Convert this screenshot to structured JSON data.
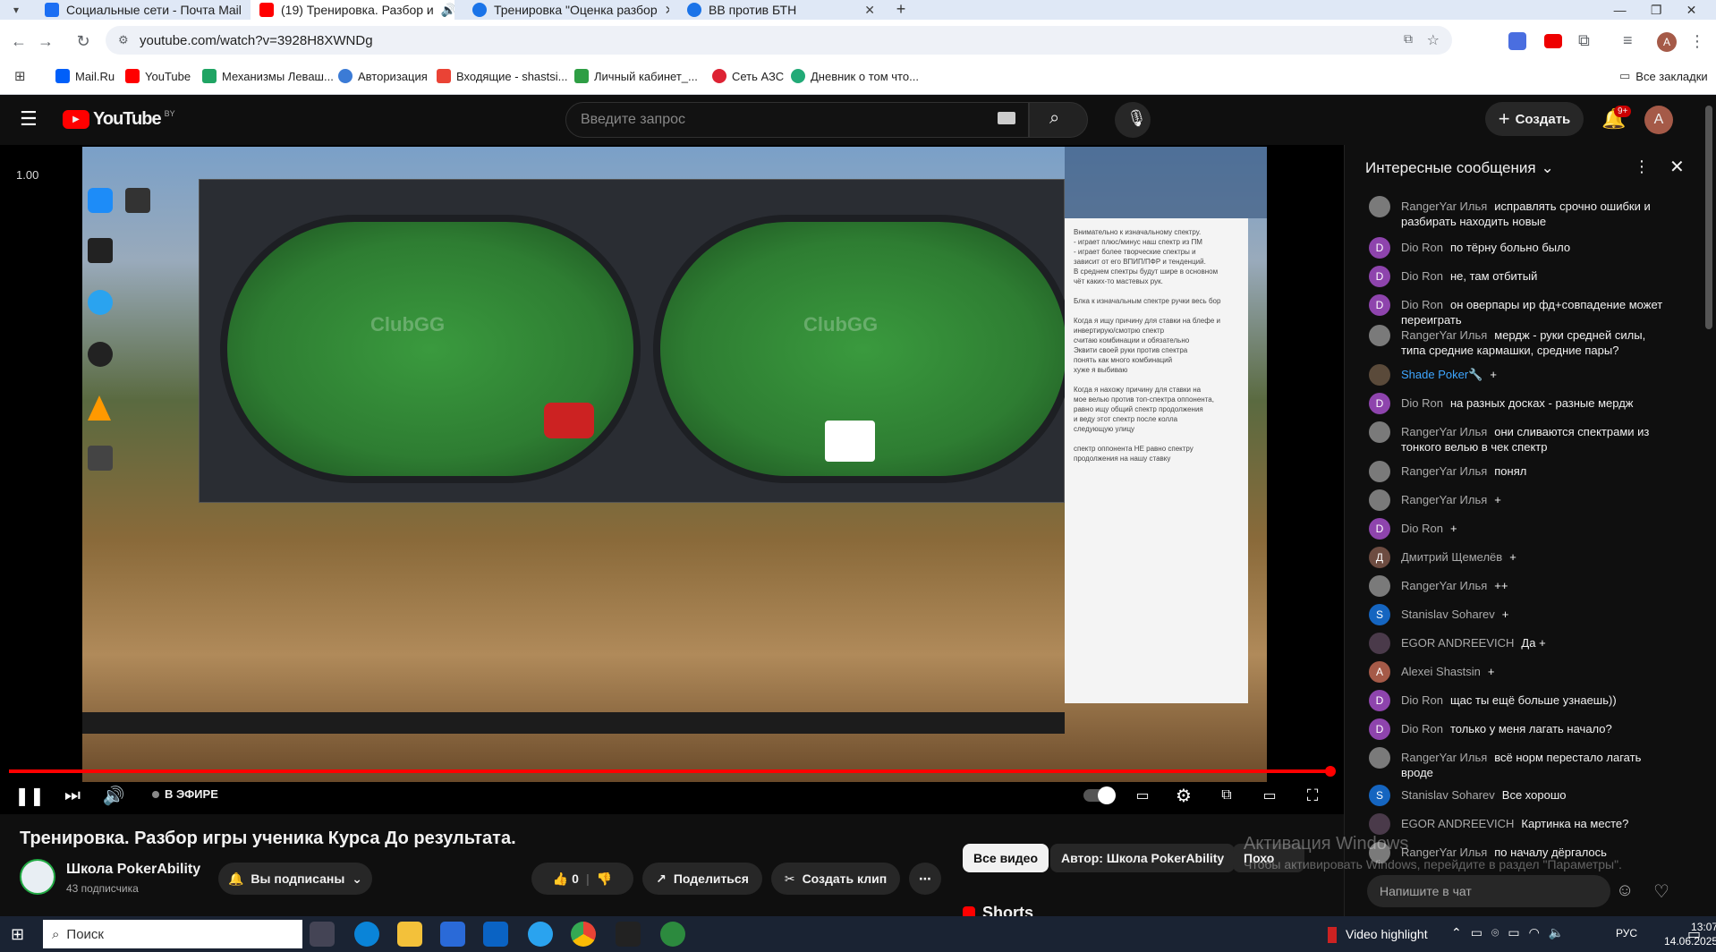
{
  "browser": {
    "tabs": [
      {
        "title": "Социальные сети - Почта Mail",
        "color": "#1b6ef3"
      },
      {
        "title": "(19) Тренировка. Разбор и",
        "color": "#ff0000"
      },
      {
        "title": "Тренировка \"Оценка разбор",
        "color": "#1a73e8"
      },
      {
        "title": "BB против БТН",
        "color": "#1a73e8"
      }
    ],
    "url": "youtube.com/watch?v=3928H8XWNDg",
    "bookmarks": [
      {
        "label": "Mail.Ru",
        "color": "#005ff9"
      },
      {
        "label": "YouTube",
        "color": "#ff0000"
      },
      {
        "label": "Механизмы Леваш...",
        "color": "#1fa463"
      },
      {
        "label": "Авторизация",
        "color": "#3b7bd6"
      },
      {
        "label": "Входящие - shastsi...",
        "color": "#ea4335"
      },
      {
        "label": "Личный кабинет_...",
        "color": "#2e9e44"
      },
      {
        "label": "Сеть АЗС",
        "color": "#d23"
      },
      {
        "label": "Дневник о том что...",
        "color": "#2a7"
      }
    ],
    "all_bookmarks": "Все закладки"
  },
  "youtube": {
    "logo": "YouTube",
    "region": "BY",
    "search_placeholder": "Введите запрос",
    "create_label": "Создать",
    "notifications": "9+",
    "avatar_letter": "A"
  },
  "video": {
    "speed_label": "1.00",
    "live_label": "В ЭФИРЕ",
    "title": "Тренировка. Разбор игры ученика Курса До результата.",
    "progress": 1.0,
    "notepad_text": "Внимательно к изначальному спектру.\n- играет плюс/минус наш спектр из ПМ\n- играет более творческие спектры и\nзависит от его ВПИП/ПФР и тенденций.\nВ среднем спектры будут шире в основном\nчёт каких-то мастевых рук.\n\nБлка к изначальным спектре ручки весь бор\n\nКогда я ищу причину для ставки на блефе и инвертирую/смотрю спектр\nсчитаю комбинации и обязательно\nЭквити своей руки против спектра\nпонять как много комбинаций\nхуже я выбиваю\n\nКогда я нахожу причину для ставки на\nмое велью против топ-спектра оппонента,\nравно ищу общий спектр продолжения\nи веду этот спектр после колла\nследующую улицу\n\nспектр оппонента НЕ равно спектру\nпродолжения на нашу ставку"
  },
  "channel": {
    "name": "Школа PokerAbility",
    "subscribers": "43 подписчика",
    "subscribed_label": "Вы подписаны",
    "likes": "0",
    "share_label": "Поделиться",
    "clip_label": "Создать клип"
  },
  "chips": {
    "all_videos": "Все видео",
    "author": "Автор: Школа PokerAbility",
    "similar": "Похо",
    "shorts": "Shorts"
  },
  "chat": {
    "header": "Интересные сообщения",
    "input_placeholder": "Напишите в чат",
    "messages": [
      {
        "author": "RangerYar Илья",
        "text": "исправлять срочно ошибки и разбирать находить новые",
        "avatar": "photo",
        "color": "#7a7a7a"
      },
      {
        "author": "Dio Ron",
        "text": "по тёрну больно было",
        "avatar": "D",
        "color": "#8e44ad"
      },
      {
        "author": "Dio Ron",
        "text": "не, там отбитый",
        "avatar": "D",
        "color": "#8e44ad"
      },
      {
        "author": "Dio Ron",
        "text": "он оверпары ир фд+совпадение может переиграть",
        "avatar": "D",
        "color": "#8e44ad"
      },
      {
        "author": "RangerYar Илья",
        "text": "мердж - руки средней силы, типа средние кармашки, средние пары?",
        "avatar": "photo",
        "color": "#7a7a7a"
      },
      {
        "author": "Shade Poker🔧",
        "text": "+",
        "avatar": "photo",
        "color": "#5a4a3a",
        "author_color": "#3ea6ff"
      },
      {
        "author": "Dio Ron",
        "text": "на разных досках - разные мердж",
        "avatar": "D",
        "color": "#8e44ad"
      },
      {
        "author": "RangerYar Илья",
        "text": "они сливаются спектрами из тонкого велью в чек спектр",
        "avatar": "photo",
        "color": "#7a7a7a"
      },
      {
        "author": "RangerYar Илья",
        "text": "понял",
        "avatar": "photo",
        "color": "#7a7a7a"
      },
      {
        "author": "RangerYar Илья",
        "text": "+",
        "avatar": "photo",
        "color": "#7a7a7a"
      },
      {
        "author": "Dio Ron",
        "text": "+",
        "avatar": "D",
        "color": "#8e44ad"
      },
      {
        "author": "Дмитрий Щемелёв",
        "text": "+",
        "avatar": "Д",
        "color": "#6d4c41"
      },
      {
        "author": "RangerYar Илья",
        "text": "++",
        "avatar": "photo",
        "color": "#7a7a7a"
      },
      {
        "author": "Stanislav Soharev",
        "text": "+",
        "avatar": "S",
        "color": "#1565c0"
      },
      {
        "author": "EGOR ANDREEVICH",
        "text": "Да +",
        "avatar": "photo",
        "color": "#4a3a4a"
      },
      {
        "author": "Alexei Shastsin",
        "text": "+",
        "avatar": "A",
        "color": "#a55a48"
      },
      {
        "author": "Dio Ron",
        "text": "щас ты ещё больше узнаешь))",
        "avatar": "D",
        "color": "#8e44ad"
      },
      {
        "author": "Dio Ron",
        "text": "только у меня лагать начало?",
        "avatar": "D",
        "color": "#8e44ad"
      },
      {
        "author": "RangerYar Илья",
        "text": "всё норм перестало лагать вроде",
        "avatar": "photo",
        "color": "#7a7a7a"
      },
      {
        "author": "Stanislav Soharev",
        "text": "Все хорошо",
        "avatar": "S",
        "color": "#1565c0"
      },
      {
        "author": "EGOR ANDREEVICH",
        "text": "Картинка на месте?",
        "avatar": "photo",
        "color": "#4a3a4a"
      },
      {
        "author": "RangerYar Илья",
        "text": "по началу дёргалось",
        "avatar": "photo",
        "color": "#7a7a7a"
      }
    ]
  },
  "windows": {
    "activation_title": "Активация Windows",
    "activation_text": "Чтобы активировать Windows, перейдите в раздел \"Параметры\".",
    "search_placeholder": "Поиск",
    "tray_label": "Video highlight",
    "language": "РУС",
    "time": "13:07",
    "date": "14.06.2025"
  }
}
